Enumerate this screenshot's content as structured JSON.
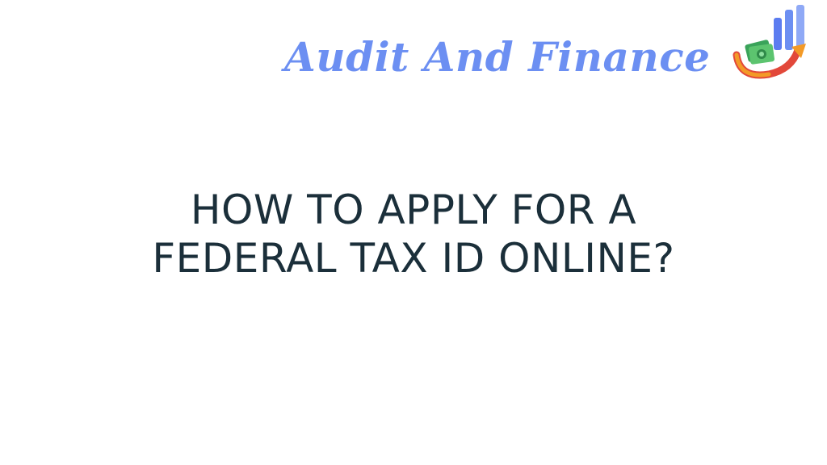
{
  "brand": {
    "name": "Audit And Finance",
    "logo_icon": "money-growth-chart-icon"
  },
  "headline": {
    "line1": "HOW TO APPLY FOR A",
    "line2": "FEDERAL TAX ID ONLINE?"
  },
  "colors": {
    "brand_text": "#6c8ff2",
    "headline_text": "#1b2f3a",
    "background": "#ffffff"
  }
}
